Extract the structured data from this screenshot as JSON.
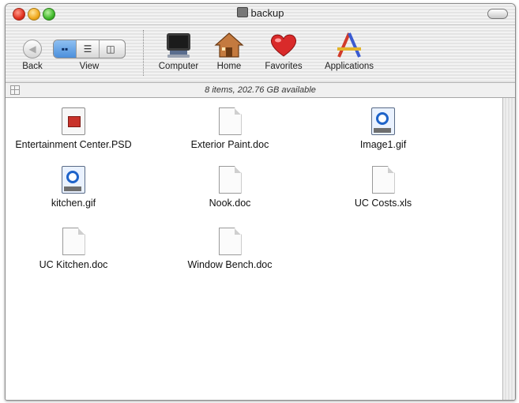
{
  "window": {
    "title": "backup"
  },
  "toolbar": {
    "back_label": "Back",
    "view_label": "View",
    "view_modes": [
      "icon-view",
      "list-view",
      "column-view"
    ],
    "locations": [
      {
        "label": "Computer",
        "icon": "computer-icon"
      },
      {
        "label": "Home",
        "icon": "home-icon"
      },
      {
        "label": "Favorites",
        "icon": "favorites-heart-icon"
      },
      {
        "label": "Applications",
        "icon": "applications-icon"
      }
    ]
  },
  "status": {
    "text": "8 items, 202.76 GB available"
  },
  "files": [
    {
      "name": "Entertainment Center.PSD",
      "type": "psd"
    },
    {
      "name": "Exterior Paint.doc",
      "type": "doc"
    },
    {
      "name": "Image1.gif",
      "type": "gif"
    },
    {
      "name": "kitchen.gif",
      "type": "gif"
    },
    {
      "name": "Nook.doc",
      "type": "doc"
    },
    {
      "name": "UC Costs.xls",
      "type": "doc"
    },
    {
      "name": "UC Kitchen.doc",
      "type": "doc"
    },
    {
      "name": "Window Bench.doc",
      "type": "doc"
    }
  ],
  "colors": {
    "accent": "#4b8fdc",
    "close": "#e0301e",
    "minimize": "#f0a81c",
    "zoom": "#3fb92a"
  }
}
